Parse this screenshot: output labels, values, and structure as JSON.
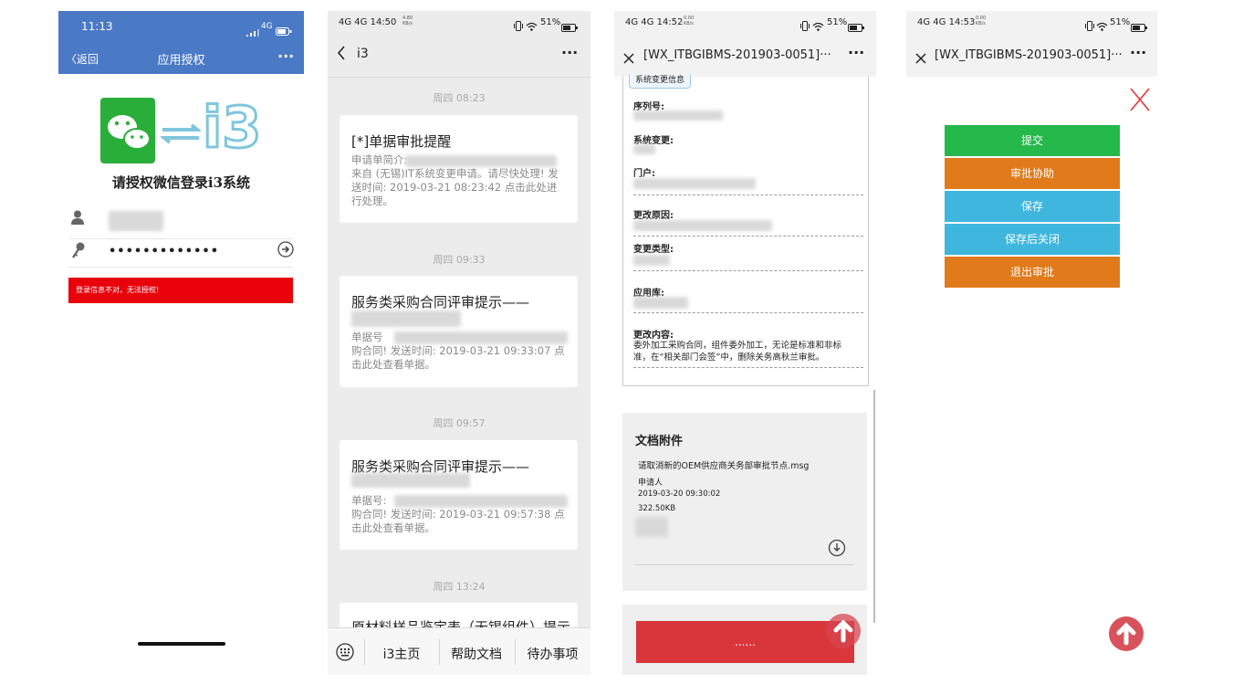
{
  "screen1": {
    "time": "11:13",
    "network": "4G",
    "back_label": "〈返回",
    "nav_title": "应用授权",
    "more": "···",
    "logo_text": "i3",
    "prompt": "请授权微信登录i3系统",
    "password_value": "•••••••••••••",
    "error_text": "登录信息不对，无法授权!",
    "colors": {
      "header": "#4a79c6",
      "error": "#e8000a",
      "wechat": "#2aae3a",
      "i3": "#7fc6dd"
    }
  },
  "screen2": {
    "status_left": "4G 4G 14:50",
    "speed": "4.80 KB/s",
    "battery": "51%",
    "nav_title": "i3",
    "more": "···",
    "times": [
      "周四 08:23",
      "周四 09:33",
      "周四 09:57",
      "周四 13:24"
    ],
    "cards": [
      {
        "title": "[*]单据审批提醒",
        "line1": "申请单简介:",
        "line2": "来自 (无锡)IT系统变更申请。请尽快处理!  发送时间: 2019-03-21 08:23:42 点击此处进行处理。"
      },
      {
        "title": "服务类采购合同评审提示——",
        "line1": "单据号",
        "line2": "购合同! 发送时间: 2019-03-21 09:33:07 点击此处查看单据。"
      },
      {
        "title": "服务类采购合同评审提示——",
        "line1": "单据号:",
        "line2": "购合同! 发送时间: 2019-03-21 09:57:38 点击此处查看单据。"
      },
      {
        "title": "原材料样品鉴定表（无锡组件）提示"
      }
    ],
    "tabs": [
      "i3主页",
      "帮助文档",
      "待办事项"
    ]
  },
  "screen3": {
    "status_left": "4G 4G 14:52",
    "speed": "0.00 KB/s",
    "battery": "51%",
    "title": "[WX_ITBGIBMS-201903-0051]···",
    "more": "···",
    "section_tag": "系统变更信息",
    "fields": [
      "序列号:",
      "系统变更:",
      "门户:",
      "更改原因:",
      "变更类型:",
      "应用库:",
      "更改内容:"
    ],
    "change_content": "委外加工采购合同，组件委外加工，无论是标准和非标准，在“相关部门会签”中，删除关务高秋兰审批。",
    "attach_title": "文档附件",
    "attach_file": "请取消新的OEM供应商关务部审批节点.msg",
    "attach_applicant": "申请人",
    "attach_date": "2019-03-20 09:30:02",
    "attach_size": "322.50KB",
    "bottom_button": "......"
  },
  "screen4": {
    "status_left": "4G 4G 14:53",
    "speed": "0.00 KB/s",
    "battery": "51%",
    "title": "[WX_ITBGIBMS-201903-0051]···",
    "more": "···",
    "menu": [
      {
        "label": "提交",
        "color": "#25b84a"
      },
      {
        "label": "审批协助",
        "color": "#e07a1a"
      },
      {
        "label": "保存",
        "color": "#3fb6dd"
      },
      {
        "label": "保存后关闭",
        "color": "#3fb6dd"
      },
      {
        "label": "退出审批",
        "color": "#e07a1a"
      }
    ]
  }
}
